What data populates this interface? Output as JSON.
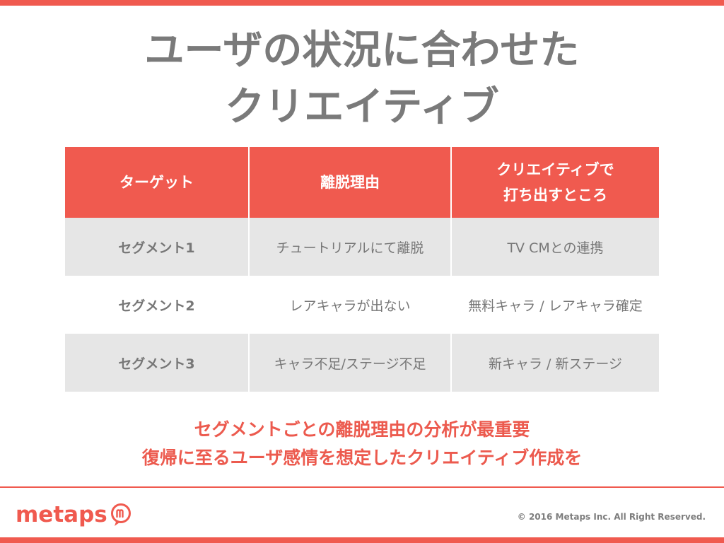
{
  "title": {
    "line1": "ユーザの状況に合わせた",
    "line2": "クリエイティブ"
  },
  "table": {
    "headers": [
      "ターゲット",
      "離脱理由",
      [
        "クリエイティブで",
        "打ち出すところ"
      ]
    ],
    "rows": [
      [
        "セグメント1",
        "チュートリアルにて離脱",
        "TV CMとの連携"
      ],
      [
        "セグメント2",
        "レアキャラが出ない",
        "無料キャラ / レアキャラ確定"
      ],
      [
        "セグメント3",
        "キャラ不足/ステージ不足",
        "新キャラ / 新ステージ"
      ]
    ]
  },
  "conclusion": {
    "line1": "セグメントごとの離脱理由の分析が最重要",
    "line2": "復帰に至るユーザ感情を想定したクリエイティブ作成を"
  },
  "footer": {
    "logo_text": "metaps",
    "logo_icon": "metaps-m-speech-bubble-icon",
    "copyright": "© 2016 Metaps Inc. All Right Reserved."
  },
  "colors": {
    "accent": "#f05a4f",
    "title_gray": "#7a7a7a",
    "row_shade": "#e6e6e6"
  }
}
